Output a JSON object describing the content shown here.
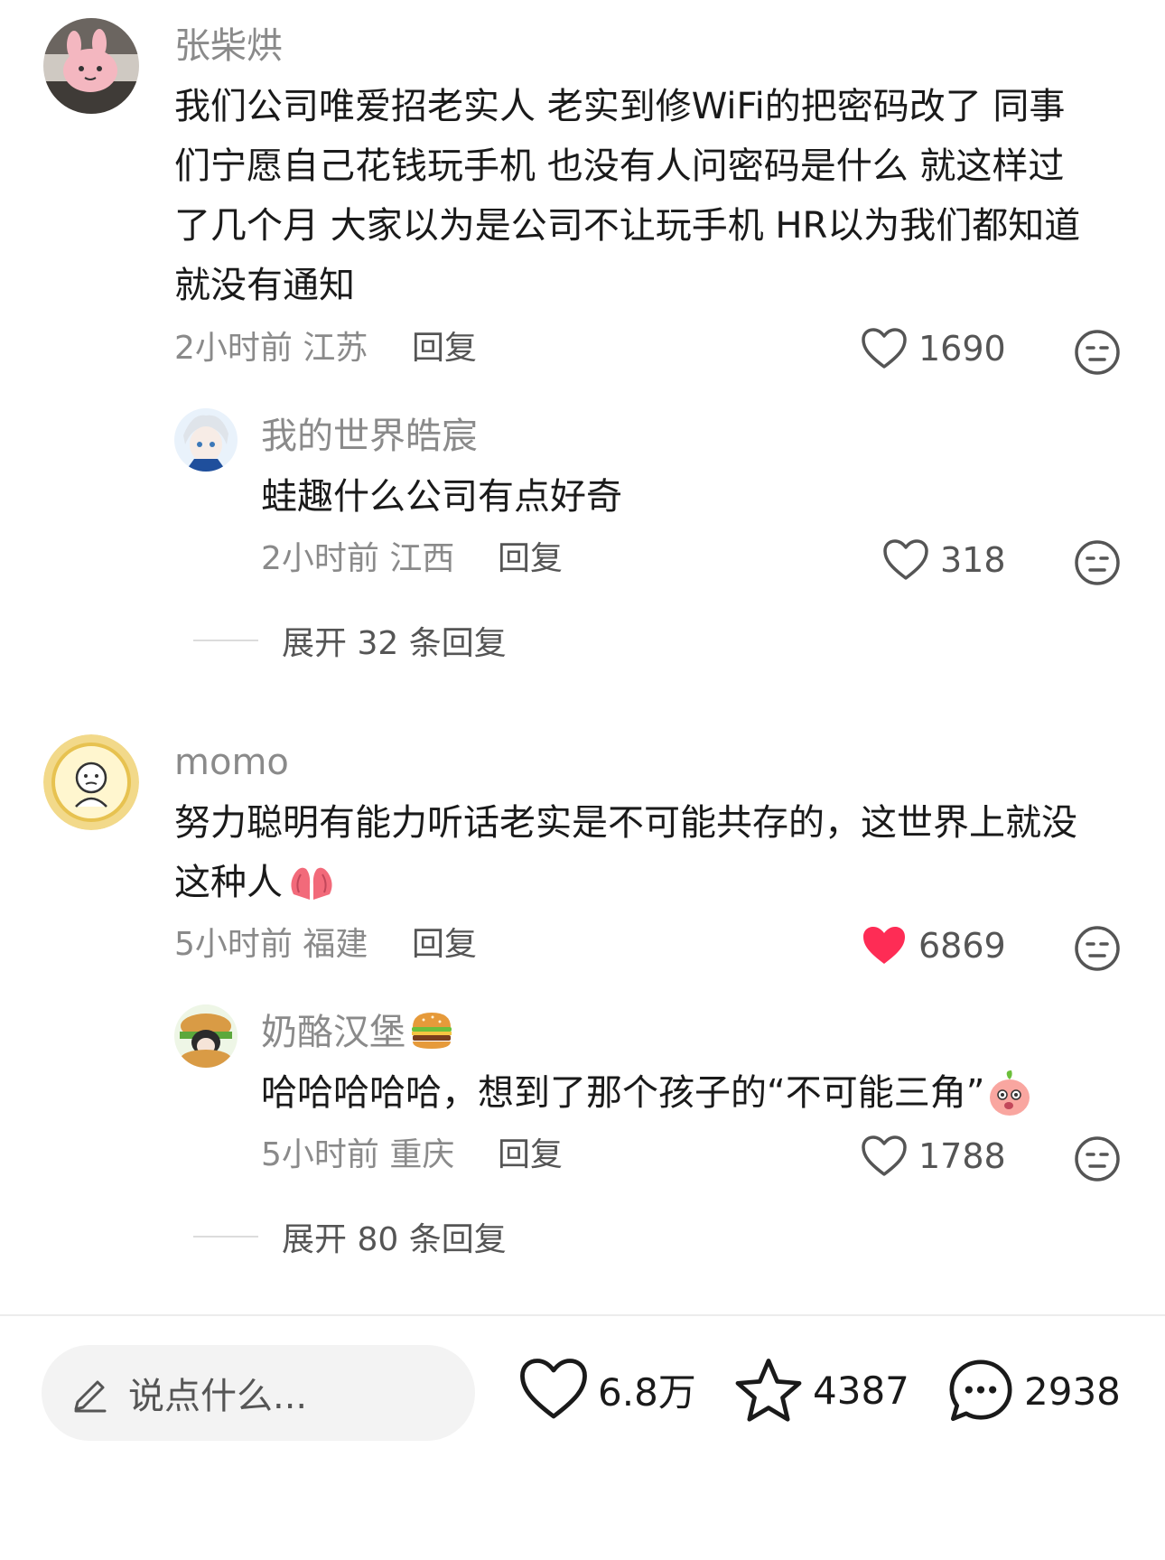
{
  "comments": [
    {
      "username": "张柴烘",
      "lines": [
        "我们公司唯爱招老实人 老实到修WiFi的把密码改了 同事",
        "们宁愿自己花钱玩手机 也没有人问密码是什么 就这样过",
        "了几个月 大家以为是公司不让玩手机 HR以为我们都知道",
        "就没有通知"
      ],
      "time": "2小时前",
      "location": "江苏",
      "reply_label": "回复",
      "likes": "1690",
      "liked": false,
      "sub_reply": {
        "username": "我的世界皓宸",
        "text": "蛙趣什么公司有点好奇",
        "time": "2小时前",
        "location": "江西",
        "reply_label": "回复",
        "likes": "318"
      },
      "expand_label": "展开 32 条回复"
    },
    {
      "username": "momo",
      "lines": [
        "努力聪明有能力听话老实是不可能共存的，这世界上就没",
        "这种人"
      ],
      "time": "5小时前",
      "location": "福建",
      "reply_label": "回复",
      "likes": "6869",
      "liked": true,
      "sub_reply": {
        "username": "奶酪汉堡",
        "text": "哈哈哈哈哈，想到了那个孩子的“不可能三角”",
        "time": "5小时前",
        "location": "重庆",
        "reply_label": "回复",
        "likes": "1788"
      },
      "expand_label": "展开 80 条回复"
    }
  ],
  "bottom_bar": {
    "input_placeholder": "说点什么...",
    "like_count": "6.8万",
    "favorite_count": "4387",
    "comment_count": "2938"
  },
  "colors": {
    "liked_heart": "#fe2c55",
    "secondary_text": "#8a8a8a"
  }
}
